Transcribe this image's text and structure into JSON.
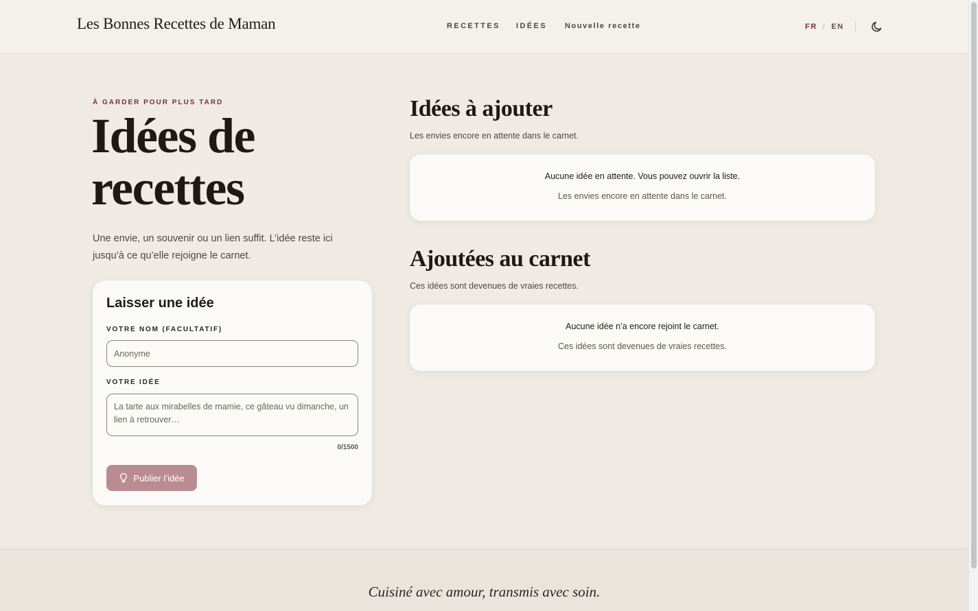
{
  "header": {
    "brand": "Les Bonnes Recettes de Maman",
    "nav": [
      "RECETTES",
      "IDÉES",
      "Nouvelle recette"
    ],
    "lang": {
      "fr": "FR",
      "sep": "/",
      "en": "EN",
      "active": "FR"
    },
    "theme_icon": "moon-icon"
  },
  "intro": {
    "eyebrow": "À GARDER POUR PLUS TARD",
    "title": "Idées de recettes",
    "subtitle": "Une envie, un souvenir ou un lien suffit. L’idée reste ici jusqu’à ce qu’elle rejoigne le carnet."
  },
  "form": {
    "title": "Laisser une idée",
    "name_label": "VOTRE NOM (FACULTATIF)",
    "name_placeholder": "Anonyme",
    "idea_label": "VOTRE IDÉE",
    "idea_placeholder": "La tarte aux mirabelles de mamie, ce gâteau vu dimanche, un lien à retrouver…",
    "counter": "0/1500",
    "submit": "Publier l’idée",
    "submit_icon": "lightbulb-icon"
  },
  "pending": {
    "title": "Idées à ajouter",
    "subtitle": "Les envies encore en attente dans le carnet.",
    "empty_title": "Aucune idée en attente. Vous pouvez ouvrir la liste.",
    "empty_sub": "Les envies encore en attente dans le carnet."
  },
  "added": {
    "title": "Ajoutées au carnet",
    "subtitle": "Ces idées sont devenues de vraies recettes.",
    "empty_title": "Aucune idée n’a encore rejoint le carnet.",
    "empty_sub": "Ces idées sont devenues de vraies recettes."
  },
  "footer": {
    "tagline": "Cuisiné avec amour, transmis avec soin."
  },
  "colors": {
    "accent": "#7d2b3d",
    "button": "#b98b93",
    "background": "#efebe4"
  }
}
